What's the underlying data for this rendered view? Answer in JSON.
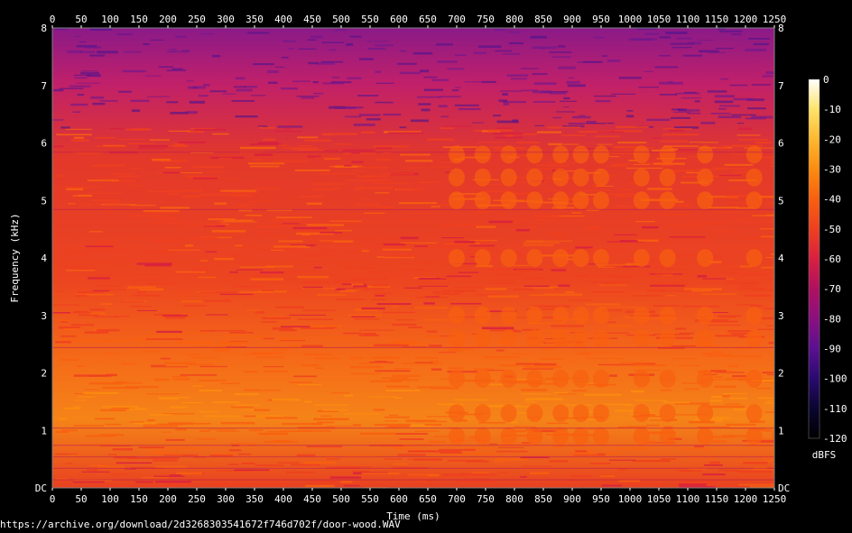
{
  "chart_data": {
    "type": "heatmap",
    "title": "",
    "xlabel": "Time (ms)",
    "ylabel": "Frequency (kHz)",
    "xlim": [
      0,
      1250
    ],
    "ylim": [
      0,
      8
    ],
    "x_ticks": [
      "0",
      "50",
      "100",
      "150",
      "200",
      "250",
      "300",
      "350",
      "400",
      "450",
      "500",
      "550",
      "600",
      "650",
      "700",
      "750",
      "800",
      "850",
      "900",
      "950",
      "1000",
      "1050",
      "1100",
      "1150",
      "1200",
      "1250"
    ],
    "y_ticks": [
      "DC",
      "1",
      "2",
      "3",
      "4",
      "5",
      "6",
      "7",
      "8"
    ],
    "colorbar": {
      "label": "dBFS",
      "range": [
        -120,
        0
      ],
      "ticks": [
        "0",
        "-10",
        "-20",
        "-30",
        "-40",
        "-50",
        "-60",
        "-70",
        "-80",
        "-90",
        "-100",
        "-110",
        "-120"
      ],
      "colors": [
        "#000000",
        "#0a0530",
        "#2a0a70",
        "#5a1090",
        "#8a1080",
        "#b01060",
        "#d82040",
        "#ee4020",
        "#f86010",
        "#fb8c10",
        "#fdb830",
        "#fde36a",
        "#ffffff"
      ]
    },
    "hot_bands_khz": [
      {
        "center": 1.5,
        "level_dbfs": -25
      },
      {
        "center": 1.0,
        "level_dbfs": -35
      },
      {
        "center": 2.3,
        "level_dbfs": -35
      },
      {
        "center": 5.0,
        "level_dbfs": -40
      }
    ],
    "grid": false
  },
  "source_url": "https://archive.org/download/2d3268303541672f746d702f/door-wood.WAV"
}
